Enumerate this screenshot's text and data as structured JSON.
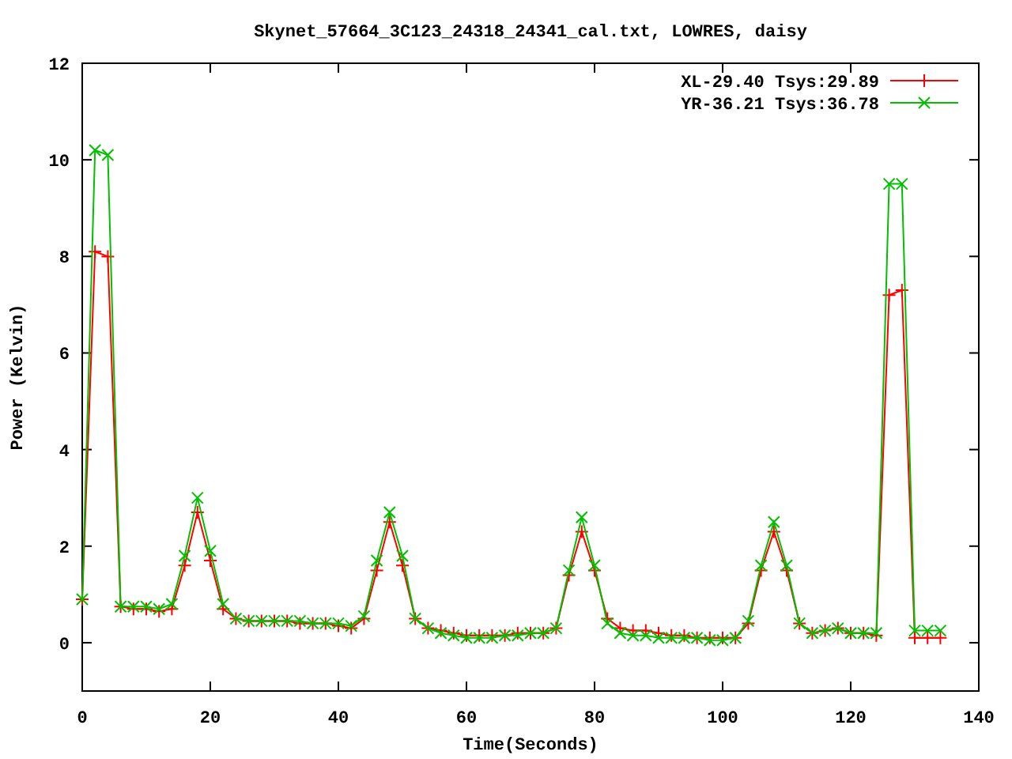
{
  "chart_data": {
    "type": "line",
    "title": "Skynet_57664_3C123_24318_24341_cal.txt, LOWRES, daisy",
    "xlabel": "Time(Seconds)",
    "ylabel": "Power (Kelvin)",
    "x": [
      0,
      2,
      4,
      6,
      8,
      10,
      12,
      14,
      16,
      18,
      20,
      22,
      24,
      26,
      28,
      30,
      32,
      34,
      36,
      38,
      40,
      42,
      44,
      46,
      48,
      50,
      52,
      54,
      56,
      58,
      60,
      62,
      64,
      66,
      68,
      70,
      72,
      74,
      76,
      78,
      80,
      82,
      84,
      86,
      88,
      90,
      92,
      94,
      96,
      98,
      100,
      102,
      104,
      106,
      108,
      110,
      112,
      114,
      116,
      118,
      120,
      122,
      124,
      126,
      128,
      130,
      132,
      134
    ],
    "series": [
      {
        "name": "XL-29.40 Tsys:29.89",
        "color": "#ff0000",
        "values": [
          0.9,
          8.1,
          8.0,
          0.75,
          0.7,
          0.7,
          0.65,
          0.7,
          1.6,
          2.7,
          1.7,
          0.7,
          0.5,
          0.45,
          0.45,
          0.45,
          0.45,
          0.4,
          0.4,
          0.4,
          0.35,
          0.3,
          0.5,
          1.5,
          2.5,
          1.6,
          0.5,
          0.3,
          0.25,
          0.2,
          0.15,
          0.15,
          0.15,
          0.15,
          0.2,
          0.2,
          0.2,
          0.3,
          1.4,
          2.3,
          1.5,
          0.5,
          0.3,
          0.25,
          0.25,
          0.2,
          0.15,
          0.15,
          0.1,
          0.1,
          0.1,
          0.1,
          0.4,
          1.5,
          2.3,
          1.5,
          0.4,
          0.2,
          0.25,
          0.3,
          0.2,
          0.2,
          0.15,
          7.2,
          7.3,
          0.1,
          0.1,
          0.1
        ]
      },
      {
        "name": "YR-36.21 Tsys:36.78",
        "color": "#00c000",
        "values": [
          0.9,
          10.2,
          10.1,
          0.75,
          0.75,
          0.75,
          0.7,
          0.8,
          1.8,
          3.0,
          1.9,
          0.8,
          0.5,
          0.45,
          0.45,
          0.45,
          0.45,
          0.45,
          0.4,
          0.4,
          0.4,
          0.35,
          0.55,
          1.7,
          2.7,
          1.8,
          0.5,
          0.3,
          0.2,
          0.15,
          0.1,
          0.1,
          0.1,
          0.15,
          0.15,
          0.2,
          0.2,
          0.3,
          1.5,
          2.6,
          1.6,
          0.4,
          0.2,
          0.15,
          0.15,
          0.1,
          0.1,
          0.1,
          0.1,
          0.05,
          0.05,
          0.1,
          0.45,
          1.6,
          2.5,
          1.6,
          0.4,
          0.2,
          0.25,
          0.3,
          0.2,
          0.2,
          0.2,
          9.5,
          9.5,
          0.25,
          0.25,
          0.25
        ]
      }
    ],
    "legend": true,
    "xlim": [
      0,
      140
    ],
    "ylim": [
      -1,
      12
    ],
    "xticks": [
      0,
      20,
      40,
      60,
      80,
      100,
      120,
      140
    ],
    "yticks": [
      0,
      2,
      4,
      6,
      8,
      10,
      12
    ]
  }
}
